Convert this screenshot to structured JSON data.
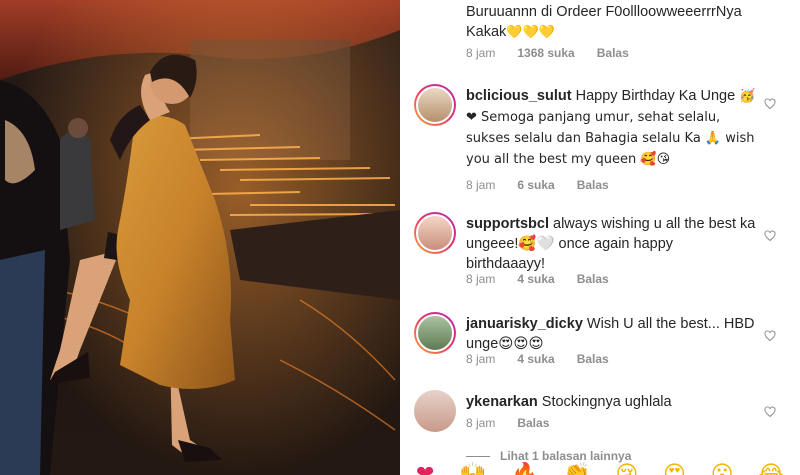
{
  "comments": [
    {
      "username": "",
      "text": "Buruuannn di Ordeer F0ollloowweeerrrNya Kakak",
      "emoji_suffix": "💛💛💛",
      "time": "8 jam",
      "likes": "1368 suka",
      "reply": "Balas"
    },
    {
      "username": "bclicious_sulut",
      "text": "Happy Birthday Ka Unge",
      "text2": "🥳❤ Semoga panjang umur, sehat selalu, sukses selalu dan Bahagia selalu Ka 🙏 wish you all the best my queen 🥰😘",
      "time": "8 jam",
      "likes": "6 suka",
      "reply": "Balas"
    },
    {
      "username": "supportsbcl",
      "text": "always wishing u all the best ka ungeee!🥰🤍 once again happy birthdaaayy!",
      "time": "8 jam",
      "likes": "4 suka",
      "reply": "Balas"
    },
    {
      "username": "januarisky_dicky",
      "text": "Wish U all the best... HBD unge😍😍😍",
      "time": "8 jam",
      "likes": "4 suka",
      "reply": "Balas"
    },
    {
      "username": "ykenarkan",
      "text": "Stockingnya ughlala",
      "time": "8 jam",
      "likes": "",
      "reply": "Balas"
    }
  ],
  "view_replies": "Lihat 1 balasan lainnya",
  "emoji_bar": [
    "❤",
    "🙌",
    "🔥",
    "👏",
    "😢",
    "😍",
    "😮",
    "😂"
  ],
  "colors": {
    "username": "#262626",
    "meta": "#8e8e8e",
    "story_ring_start": "#f9a53a",
    "story_ring_end": "#b32bbd"
  },
  "icons": {
    "like": "heart-outline-icon"
  }
}
